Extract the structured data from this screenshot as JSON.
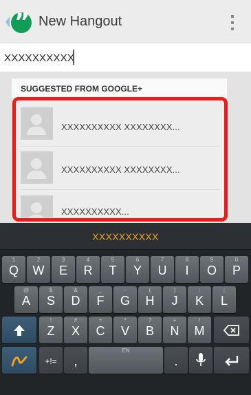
{
  "app_bar": {
    "title": "New Hangout"
  },
  "input": {
    "value": "XXXXXXXXXX"
  },
  "suggestions": {
    "header": "SUGGESTED FROM GOOGLE+",
    "rows": [
      {
        "name": "XXXXXXXXXX XXXXXXXX..."
      },
      {
        "name": "XXXXXXXXXX XXXXXXXX..."
      },
      {
        "name": "XXXXXXXXXX..."
      }
    ]
  },
  "keyboard": {
    "suggestion": "XXXXXXXXXX",
    "row1": [
      {
        "label": "Q",
        "sub": "1"
      },
      {
        "label": "W",
        "sub": "2"
      },
      {
        "label": "E",
        "sub": "3"
      },
      {
        "label": "R",
        "sub": "4"
      },
      {
        "label": "T",
        "sub": "5"
      },
      {
        "label": "Y",
        "sub": "6"
      },
      {
        "label": "U",
        "sub": "7"
      },
      {
        "label": "I",
        "sub": "8"
      },
      {
        "label": "O",
        "sub": "9"
      },
      {
        "label": "P",
        "sub": "0"
      }
    ],
    "row2": [
      {
        "label": "A",
        "sub": "@"
      },
      {
        "label": "S",
        "sub": "$"
      },
      {
        "label": "D",
        "sub": "&"
      },
      {
        "label": "F",
        "sub": "_"
      },
      {
        "label": "G",
        "sub": "-"
      },
      {
        "label": "H",
        "sub": "("
      },
      {
        "label": "J",
        "sub": ")"
      },
      {
        "label": "K",
        "sub": ":"
      },
      {
        "label": "L",
        "sub": ";"
      }
    ],
    "row3": [
      {
        "label": "Z",
        "sub": "!"
      },
      {
        "label": "X",
        "sub": "#"
      },
      {
        "label": "C",
        "sub": "="
      },
      {
        "label": "V",
        "sub": "*"
      },
      {
        "label": "B",
        "sub": "?"
      },
      {
        "label": "N",
        "sub": "+"
      },
      {
        "label": "M",
        "sub": "/"
      }
    ],
    "symbols_label": "+!=",
    "comma": ",",
    "space_label": "EN",
    "period": "."
  }
}
